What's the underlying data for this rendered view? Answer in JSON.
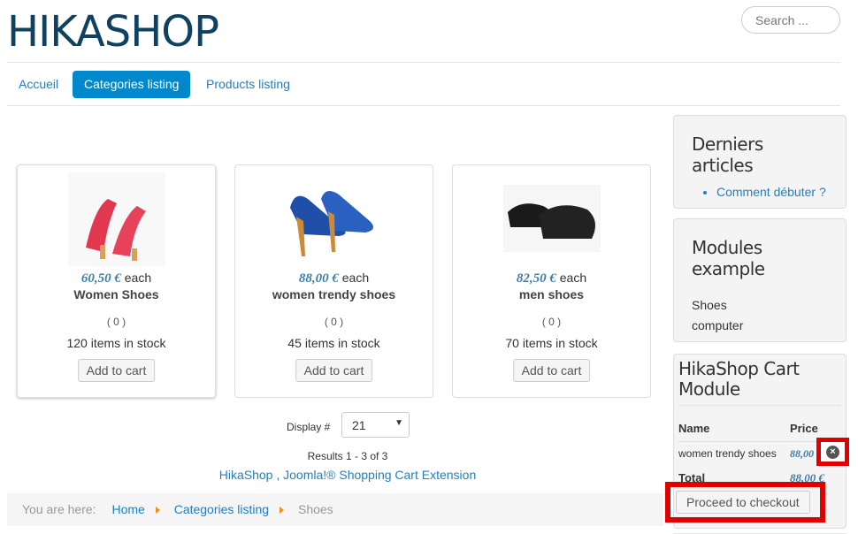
{
  "header": {
    "logo": "HIKASHOP",
    "search_placeholder": "Search ..."
  },
  "nav": [
    {
      "label": "Accueil"
    },
    {
      "label": "Categories listing",
      "active": true
    },
    {
      "label": "Products listing"
    }
  ],
  "products": [
    {
      "price": "60,50 €",
      "each": " each",
      "name": "Women Shoes",
      "rating": "( 0 )",
      "stock": "120 items in stock",
      "button": "Add to cart",
      "image": "red-sandal"
    },
    {
      "price": "88,00 €",
      "each": " each",
      "name": "women trendy shoes",
      "rating": "( 0 )",
      "stock": "45 items in stock",
      "button": "Add to cart",
      "image": "blue-pump"
    },
    {
      "price": "82,50 €",
      "each": " each",
      "name": "men shoes",
      "rating": "( 0 )",
      "stock": "70 items in stock",
      "button": "Add to cart",
      "image": "black-oxford"
    }
  ],
  "pagination": {
    "display_label": "Display #",
    "display_value": "21",
    "results": "Results 1 - 3 of 3"
  },
  "footer_link": {
    "part1": "HikaShop",
    "sep": " , ",
    "part2": "Joomla!® Shopping Cart Extension"
  },
  "breadcrumb": {
    "label": "You are here:",
    "items": [
      "Home",
      "Categories listing",
      "Shoes"
    ]
  },
  "sidebar": {
    "latest": {
      "title": "Derniers articles",
      "items": [
        "Comment débuter ?"
      ]
    },
    "modules": {
      "title": "Modules example",
      "items": [
        "Shoes",
        "computer"
      ]
    },
    "cart": {
      "title": "HikaShop Cart Module",
      "col_name": "Name",
      "col_price": "Price",
      "item_name": "women trendy shoes",
      "item_price": "88,00 €",
      "total_label": "Total",
      "total": "88,00 €",
      "checkout": "Proceed to checkout"
    }
  },
  "colors": {
    "brand": "#0f4261",
    "accent": "#0088cc",
    "highlight": "#e00000"
  }
}
